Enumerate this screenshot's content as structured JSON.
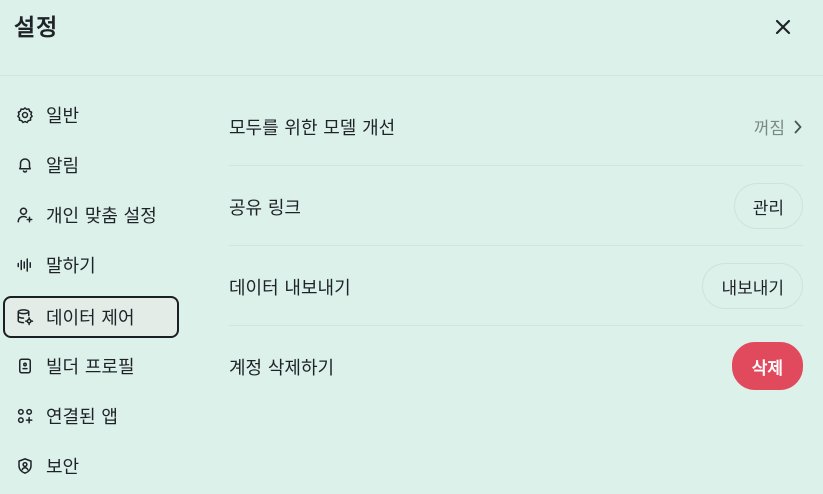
{
  "header": {
    "title": "설정"
  },
  "sidebar": {
    "items": [
      {
        "label": "일반",
        "icon": "gear-icon"
      },
      {
        "label": "알림",
        "icon": "bell-icon"
      },
      {
        "label": "개인 맞춤 설정",
        "icon": "person-sparkle-icon"
      },
      {
        "label": "말하기",
        "icon": "waveform-icon"
      },
      {
        "label": "데이터 제어",
        "icon": "database-gear-icon",
        "active": true
      },
      {
        "label": "빌더 프로필",
        "icon": "id-badge-icon"
      },
      {
        "label": "연결된 앱",
        "icon": "apps-grid-icon"
      },
      {
        "label": "보안",
        "icon": "shield-person-icon"
      }
    ]
  },
  "main": {
    "rows": [
      {
        "label": "모두를 위한 모델 개선",
        "value": "꺼짐"
      },
      {
        "label": "공유 링크",
        "button": "관리"
      },
      {
        "label": "데이터 내보내기",
        "button": "내보내기"
      },
      {
        "label": "계정 삭제하기",
        "button": "삭제"
      }
    ]
  },
  "colors": {
    "background": "#dcf1ea",
    "danger": "#e14a5c",
    "muted_text": "#7b8a86"
  }
}
